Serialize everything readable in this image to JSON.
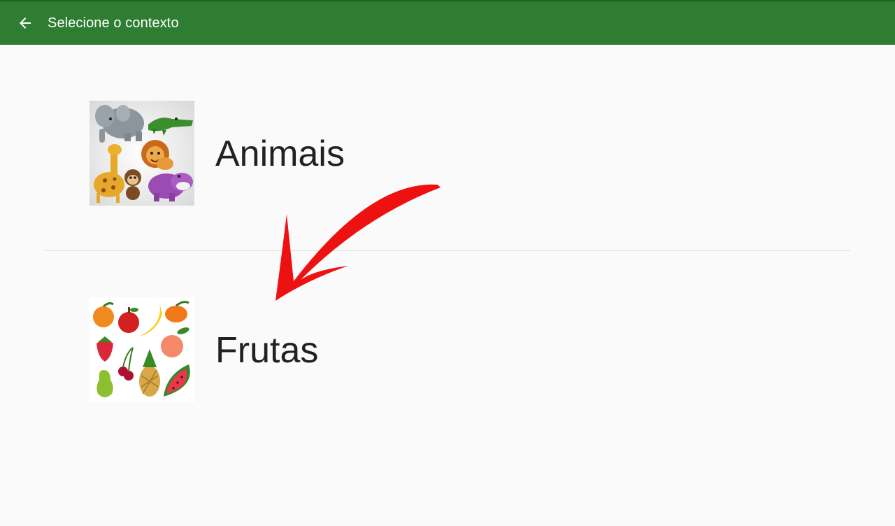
{
  "toolbar": {
    "title": "Selecione o contexto",
    "back_icon": "arrow-back-icon",
    "color": "#2e7d32"
  },
  "contexts": [
    {
      "label": "Animais",
      "icon": "animals-collage-image"
    },
    {
      "label": "Frutas",
      "icon": "fruits-collage-image"
    }
  ],
  "annotation": {
    "icon": "red-arrow-annotation",
    "color": "#ee1111"
  }
}
